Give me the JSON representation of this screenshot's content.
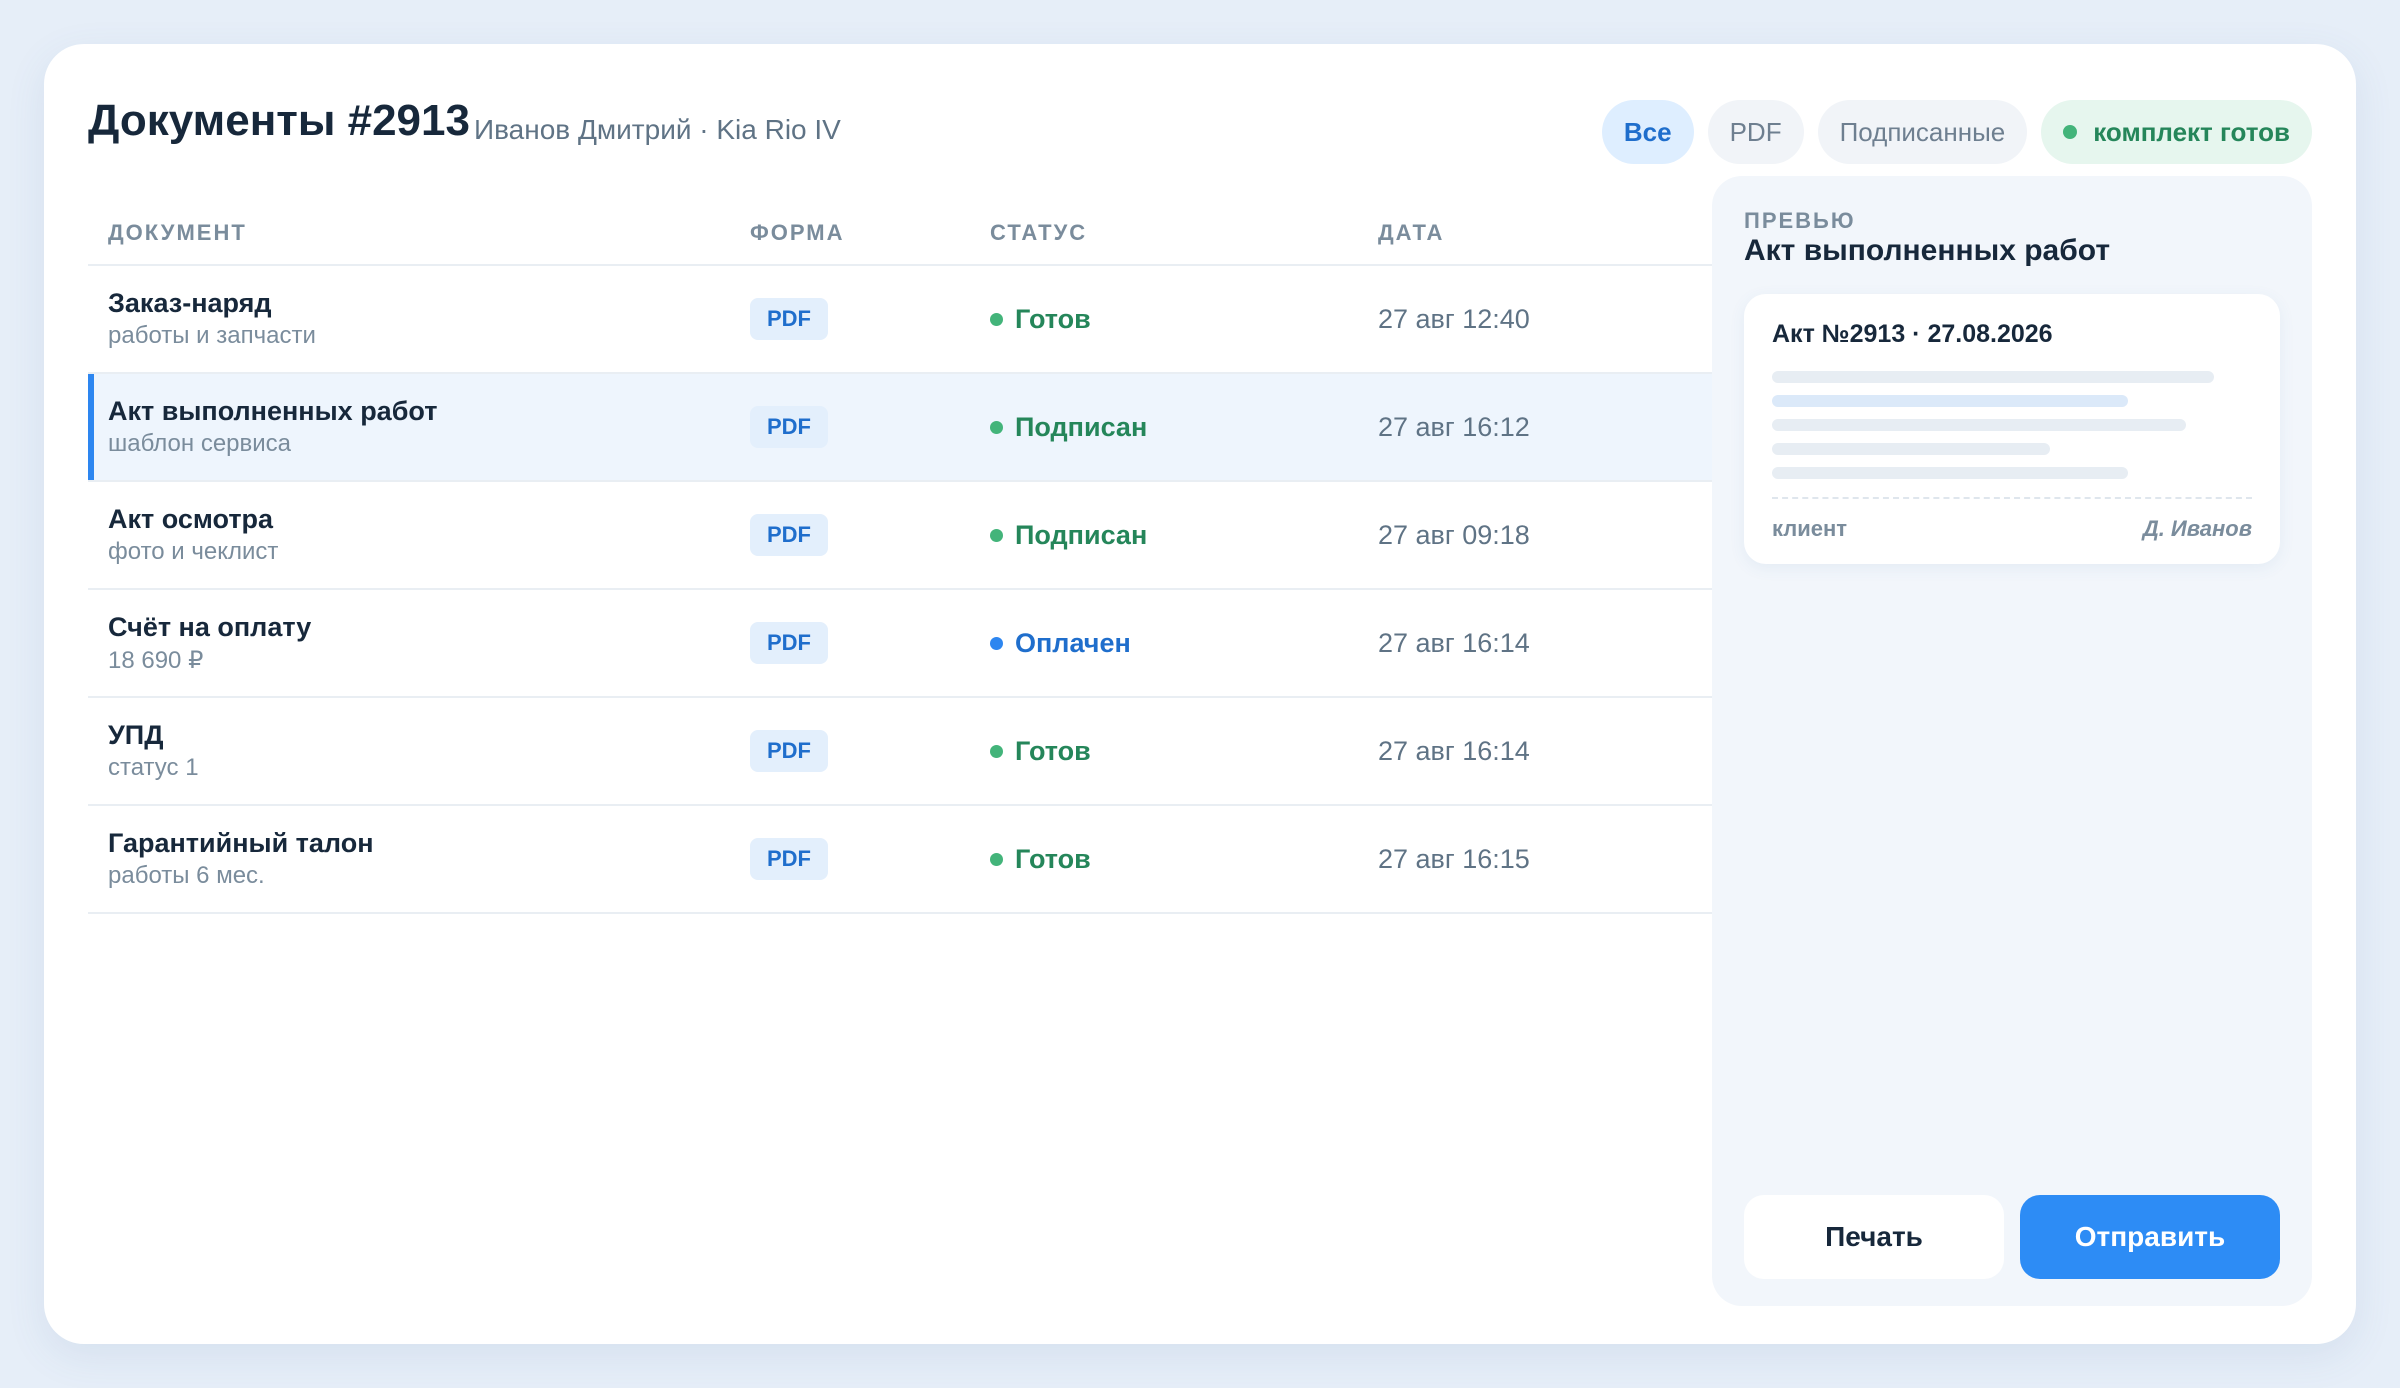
{
  "header": {
    "title": "Документы #2913",
    "subtitle": "Иванов Дмитрий · Kia Rio IV",
    "filters": [
      {
        "label": "Все",
        "active": true
      },
      {
        "label": "PDF",
        "active": false
      },
      {
        "label": "Подписанные",
        "active": false
      }
    ],
    "ready_badge": "комплект готов"
  },
  "table": {
    "columns": [
      "ДОКУМЕНТ",
      "ФОРМА",
      "СТАТУС",
      "ДАТА"
    ],
    "rows": [
      {
        "name": "Заказ-наряд",
        "sub": "работы и запчасти",
        "form": "PDF",
        "status": "Готов",
        "status_color": "#25865a",
        "date": "27 авг 12:40",
        "selected": false
      },
      {
        "name": "Акт выполненных работ",
        "sub": "шаблон сервиса",
        "form": "PDF",
        "status": "Подписан",
        "status_color": "#25865a",
        "date": "27 авг 16:12",
        "selected": true
      },
      {
        "name": "Акт осмотра",
        "sub": "фото и чеклист",
        "form": "PDF",
        "status": "Подписан",
        "status_color": "#25865a",
        "date": "27 авг 09:18",
        "selected": false
      },
      {
        "name": "Счёт на оплату",
        "sub": "18 690 ₽",
        "form": "PDF",
        "status": "Оплачен",
        "status_color": "#1f6ecc",
        "date": "27 авг 16:14",
        "selected": false
      },
      {
        "name": "УПД",
        "sub": "статус 1",
        "form": "PDF",
        "status": "Готов",
        "status_color": "#25865a",
        "date": "27 авг 16:14",
        "selected": false
      },
      {
        "name": "Гарантийный талон",
        "sub": "работы 6 мес.",
        "form": "PDF",
        "status": "Готов",
        "status_color": "#25865a",
        "date": "27 авг 16:15",
        "selected": false
      }
    ]
  },
  "preview": {
    "label": "ПРЕВЬЮ",
    "title": "Акт выполненных работ",
    "doc_heading": "Акт №2913 · 27.08.2026",
    "client_label": "клиент",
    "signature": "Д. Иванов",
    "print_label": "Печать",
    "send_label": "Отправить"
  },
  "colors": {
    "accent": "#2d8cf5",
    "ready": "#25865a",
    "background": "#e6eef8"
  }
}
